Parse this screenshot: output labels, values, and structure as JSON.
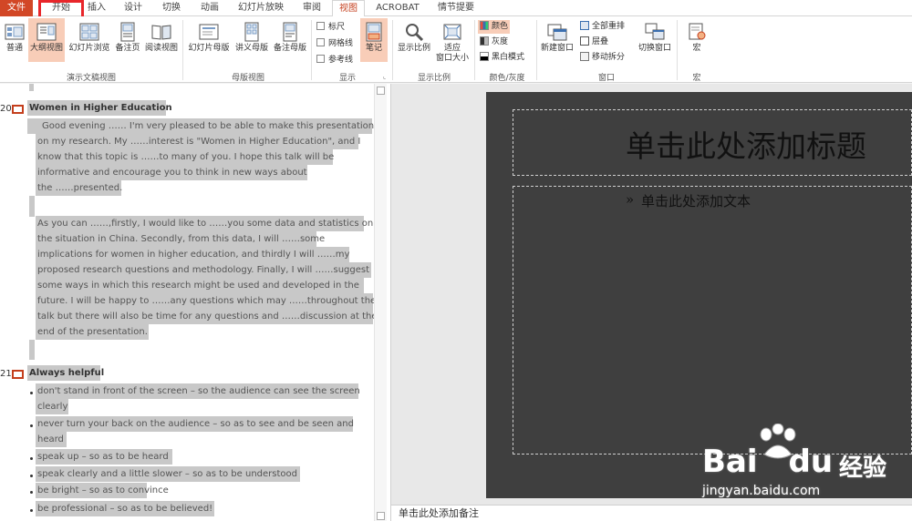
{
  "tabs": [
    "文件",
    "开始",
    "插入",
    "设计",
    "切换",
    "动画",
    "幻灯片放映",
    "审阅",
    "视图",
    "ACROBAT",
    "情节提要"
  ],
  "active_tab": "视图",
  "ribbon": {
    "presentation_views": {
      "label": "演示文稿视图",
      "buttons": [
        "普通",
        "大纲视图",
        "幻灯片浏览",
        "备注页",
        "阅读视图"
      ],
      "active": "大纲视图"
    },
    "master_views": {
      "label": "母版视图",
      "buttons": [
        "幻灯片母版",
        "讲义母版",
        "备注母版"
      ]
    },
    "show": {
      "label": "显示",
      "checkboxes": [
        "标尺",
        "网格线",
        "参考线"
      ],
      "notes": "笔记"
    },
    "zoom": {
      "label": "显示比例",
      "buttons": [
        "显示比例",
        "适应\n窗口大小"
      ]
    },
    "color": {
      "label": "颜色/灰度",
      "options": [
        "颜色",
        "灰度",
        "黑白模式"
      ],
      "active": "颜色"
    },
    "window": {
      "label": "窗口",
      "new_window": "新建窗口",
      "options": [
        "全部重排",
        "层叠",
        "移动拆分"
      ],
      "switch": "切换窗口"
    },
    "macros": {
      "label": "宏",
      "button": "宏"
    }
  },
  "outline": {
    "slides": [
      {
        "number": "20",
        "title": "Women in Higher Education",
        "lines": [
          "Good evening …… I'm very pleased to be able to make this presentation",
          "on my research.  My ……interest is \"Women in Higher Education\", and I",
          "know that this topic is ……to many of you. I hope this talk will be",
          "informative and encourage you to think in new ways about",
          "the ……presented.",
          "As you can ……,firstly, I would like to ……you some data and statistics on",
          "the situation in China.  Secondly, from this data, I will ……some",
          "implications for women in higher education, and thirdly I will ……my",
          "proposed research questions and methodology.  Finally, I will ……suggest",
          "some ways in which this research might be used and developed in the",
          "future.  I will be happy to ……any questions which may ……throughout the",
          "talk but there will also be time for any questions and ……discussion at the",
          "end of the presentation."
        ]
      },
      {
        "number": "21",
        "title": "Always helpful",
        "bullets": [
          "don't stand in front of the screen – so the audience can see the screen",
          "clearly",
          "never turn your back on the audience – so as to see and be seen and",
          "heard",
          "speak up – so as to be heard",
          "speak clearly and a little slower  – so as to be understood",
          "be bright – so as to convince",
          "be professional – so as to be believed!"
        ]
      }
    ]
  },
  "slide_preview": {
    "title_placeholder": "单击此处添加标题",
    "body_placeholder": "单击此处添加文本",
    "bullet_glyph": "»"
  },
  "notes_placeholder": "单击此处添加备注",
  "watermark": {
    "brand": "Bai",
    "brand2": "du",
    "cn": "经验",
    "url": "jingyan.baidu.com"
  },
  "colors": {
    "accent": "#c43e1c",
    "file_tab": "#d24726",
    "highlight": "#e8262a",
    "slide_bg": "#3f3f3f",
    "selection": "#c8c8c8"
  }
}
